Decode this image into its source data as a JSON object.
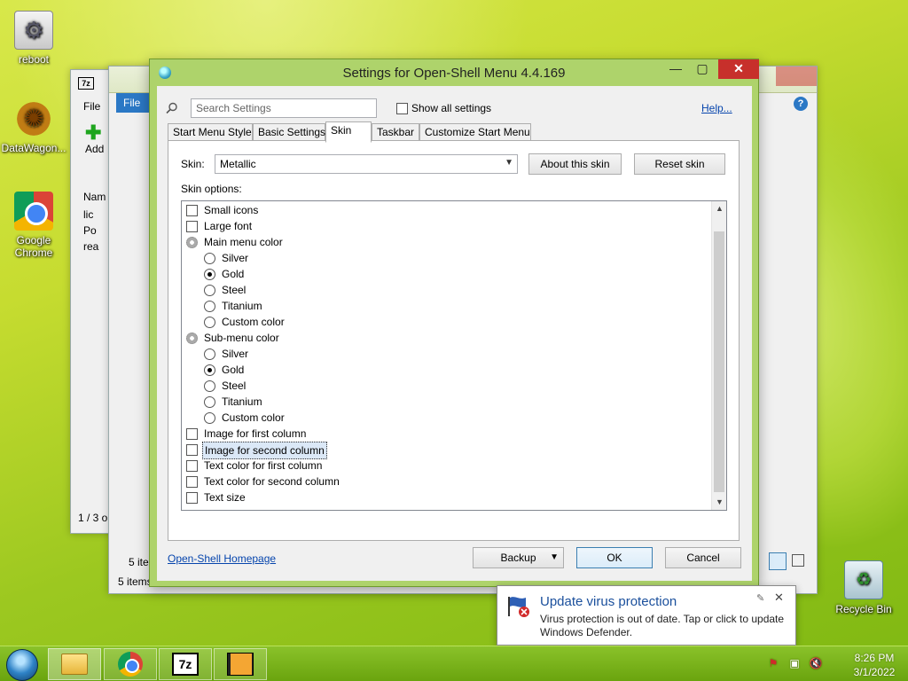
{
  "desktop": {
    "icons": [
      {
        "label": "reboot"
      },
      {
        "label": "DataWagon..."
      },
      {
        "label": "Google Chrome"
      },
      {
        "label": "Recycle Bin"
      }
    ]
  },
  "bg_window_left": {
    "title_7z": "7z",
    "menu_file": "File",
    "add_label": "Add",
    "col_name": "Nam",
    "rows": [
      "lic",
      "Po",
      "rea"
    ],
    "status": "1 / 3 o"
  },
  "bg_window_right": {
    "menu_file": "File",
    "status1": "5 ite",
    "status2": "5 items"
  },
  "dialog": {
    "title": "Settings for Open-Shell Menu 4.4.169",
    "search_placeholder": "Search Settings",
    "show_all_label": "Show all settings",
    "help_label": "Help...",
    "tabs": [
      "Start Menu Style",
      "Basic Settings",
      "Skin",
      "Taskbar",
      "Customize Start Menu"
    ],
    "active_tab": "Skin",
    "skin_label": "Skin:",
    "skin_value": "Metallic",
    "about_skin_label": "About this skin",
    "reset_skin_label": "Reset skin",
    "skin_options_label": "Skin options:",
    "options": [
      {
        "kind": "checkbox",
        "label": "Small icons",
        "checked": false
      },
      {
        "kind": "checkbox",
        "label": "Large font",
        "checked": false
      },
      {
        "kind": "group",
        "label": "Main menu color"
      },
      {
        "kind": "radio",
        "label": "Silver",
        "checked": false
      },
      {
        "kind": "radio",
        "label": "Gold",
        "checked": true
      },
      {
        "kind": "radio",
        "label": "Steel",
        "checked": false
      },
      {
        "kind": "radio",
        "label": "Titanium",
        "checked": false
      },
      {
        "kind": "radio",
        "label": "Custom color",
        "checked": false
      },
      {
        "kind": "group",
        "label": "Sub-menu color"
      },
      {
        "kind": "radio",
        "label": "Silver",
        "checked": false
      },
      {
        "kind": "radio",
        "label": "Gold",
        "checked": true
      },
      {
        "kind": "radio",
        "label": "Steel",
        "checked": false
      },
      {
        "kind": "radio",
        "label": "Titanium",
        "checked": false
      },
      {
        "kind": "radio",
        "label": "Custom color",
        "checked": false
      },
      {
        "kind": "checkbox",
        "label": "Image for first column",
        "checked": false
      },
      {
        "kind": "checkbox",
        "label": "Image for second column",
        "checked": false,
        "focused": true
      },
      {
        "kind": "checkbox",
        "label": "Text color for first column",
        "checked": false
      },
      {
        "kind": "checkbox",
        "label": "Text color for second column",
        "checked": false
      },
      {
        "kind": "checkbox",
        "label": "Text size",
        "checked": false
      }
    ],
    "homepage_label": "Open-Shell Homepage",
    "backup_label": "Backup",
    "ok_label": "OK",
    "cancel_label": "Cancel"
  },
  "toast": {
    "title": "Update virus protection",
    "message": "Virus protection is out of date. Tap or click to update Windows Defender."
  },
  "taskbar": {
    "time": "8:26 PM",
    "date": "3/1/2022",
    "app_7z": "7z"
  },
  "colors": {
    "dialog_frame": "#aed36b",
    "close_button": "#c7302b",
    "link": "#0645ad",
    "toast_title": "#1a4f9c",
    "taskbar": "#7ab21c"
  }
}
